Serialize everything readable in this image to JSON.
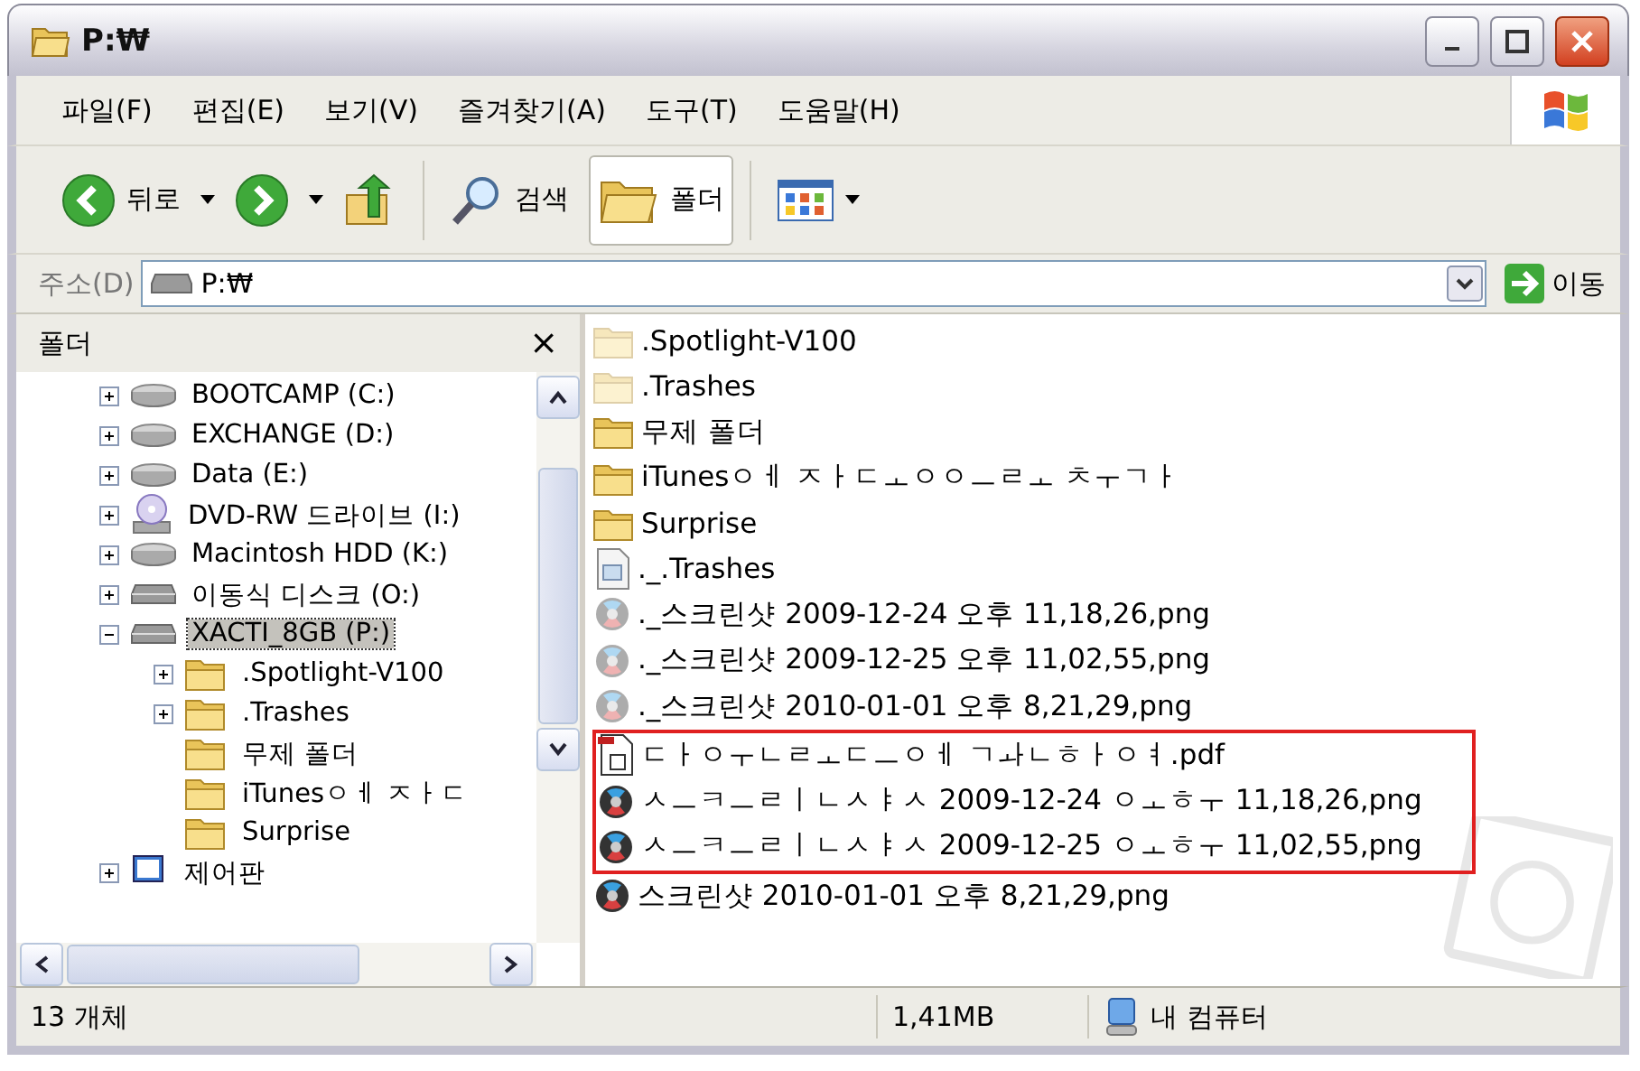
{
  "window": {
    "title": "P:₩"
  },
  "menu": [
    "파일(F)",
    "편집(E)",
    "보기(V)",
    "즐겨찾기(A)",
    "도구(T)",
    "도움말(H)"
  ],
  "toolbar": {
    "back": "뒤로",
    "search": "검색",
    "folders": {
      "label": "폴더",
      "selected": true
    }
  },
  "address": {
    "label": "주소(D)",
    "value": "P:₩",
    "go": "이동"
  },
  "folder_pane": {
    "title": "폴더",
    "close": "×",
    "tree": [
      {
        "label": "BOOTCAMP (C:)",
        "kind": "drive",
        "expandable": true,
        "expanded": false,
        "selected": false
      },
      {
        "label": "EXCHANGE (D:)",
        "kind": "drive",
        "expandable": true,
        "expanded": false,
        "selected": false
      },
      {
        "label": "Data (E:)",
        "kind": "drive",
        "expandable": true,
        "expanded": false,
        "selected": false
      },
      {
        "label": "DVD-RW 드라이브 (I:)",
        "kind": "dvd",
        "expandable": true,
        "expanded": false,
        "selected": false
      },
      {
        "label": "Macintosh HDD (K:)",
        "kind": "drive",
        "expandable": true,
        "expanded": false,
        "selected": false
      },
      {
        "label": "이동식 디스크 (O:)",
        "kind": "removable",
        "expandable": true,
        "expanded": false,
        "selected": false
      },
      {
        "label": "XACTI_8GB (P:)",
        "kind": "removable",
        "expandable": true,
        "expanded": true,
        "selected": true,
        "children": [
          {
            "label": ".Spotlight-V100",
            "kind": "folder",
            "expandable": true,
            "expanded": false,
            "selected": false
          },
          {
            "label": ".Trashes",
            "kind": "folder",
            "expandable": true,
            "expanded": false,
            "selected": false
          },
          {
            "label": "무제 폴더",
            "kind": "folder",
            "expandable": false,
            "selected": false
          },
          {
            "label": "iTunesㅇㅔ ㅈㅏㄷ",
            "kind": "folder",
            "expandable": false,
            "selected": false
          },
          {
            "label": "Surprise",
            "kind": "folder",
            "expandable": false,
            "selected": false
          }
        ]
      },
      {
        "label": "제어판",
        "kind": "control-panel",
        "expandable": true,
        "expanded": false,
        "selected": false
      }
    ]
  },
  "files": [
    {
      "name": ".Spotlight-V100",
      "kind": "folder",
      "hidden": true,
      "highlighted": false
    },
    {
      "name": ".Trashes",
      "kind": "folder",
      "hidden": true,
      "highlighted": false
    },
    {
      "name": "무제 폴더",
      "kind": "folder",
      "hidden": false,
      "highlighted": false
    },
    {
      "name": "iTunesㅇㅔ ㅈㅏㄷㅗㅇㅇㅡㄹㅗ ㅊㅜㄱㅏ",
      "kind": "folder",
      "hidden": false,
      "highlighted": false
    },
    {
      "name": "Surprise",
      "kind": "folder",
      "hidden": false,
      "highlighted": false
    },
    {
      "name": "._.Trashes",
      "kind": "file",
      "hidden": false,
      "highlighted": false
    },
    {
      "name": "._스크린샷 2009-12-24 오후 11,18,26,png",
      "kind": "image",
      "hidden": true,
      "highlighted": false
    },
    {
      "name": "._스크린샷 2009-12-25 오후 11,02,55,png",
      "kind": "image",
      "hidden": true,
      "highlighted": false
    },
    {
      "name": "._스크린샷 2010-01-01 오후 8,21,29,png",
      "kind": "image",
      "hidden": true,
      "highlighted": false
    },
    {
      "name": "ㄷㅏㅇㅜㄴㄹㅗㄷㅡㅇㅔ ㄱㅘㄴㅎㅏㅇㅕ.pdf",
      "kind": "pdf",
      "hidden": false,
      "highlighted": true
    },
    {
      "name": "ㅅㅡㅋㅡㄹㅣㄴㅅㅑㅅ 2009-12-24 ㅇㅗㅎㅜ 11,18,26,png",
      "kind": "image",
      "hidden": false,
      "highlighted": true
    },
    {
      "name": "ㅅㅡㅋㅡㄹㅣㄴㅅㅑㅅ 2009-12-25 ㅇㅗㅎㅜ 11,02,55,png",
      "kind": "image",
      "hidden": false,
      "highlighted": true
    },
    {
      "name": "스크린샷 2010-01-01 오후 8,21,29,png",
      "kind": "image",
      "hidden": false,
      "highlighted": false
    }
  ],
  "status_bar": {
    "count": "13 개체",
    "size": "1,41MB",
    "zone": "내 컴퓨터"
  }
}
